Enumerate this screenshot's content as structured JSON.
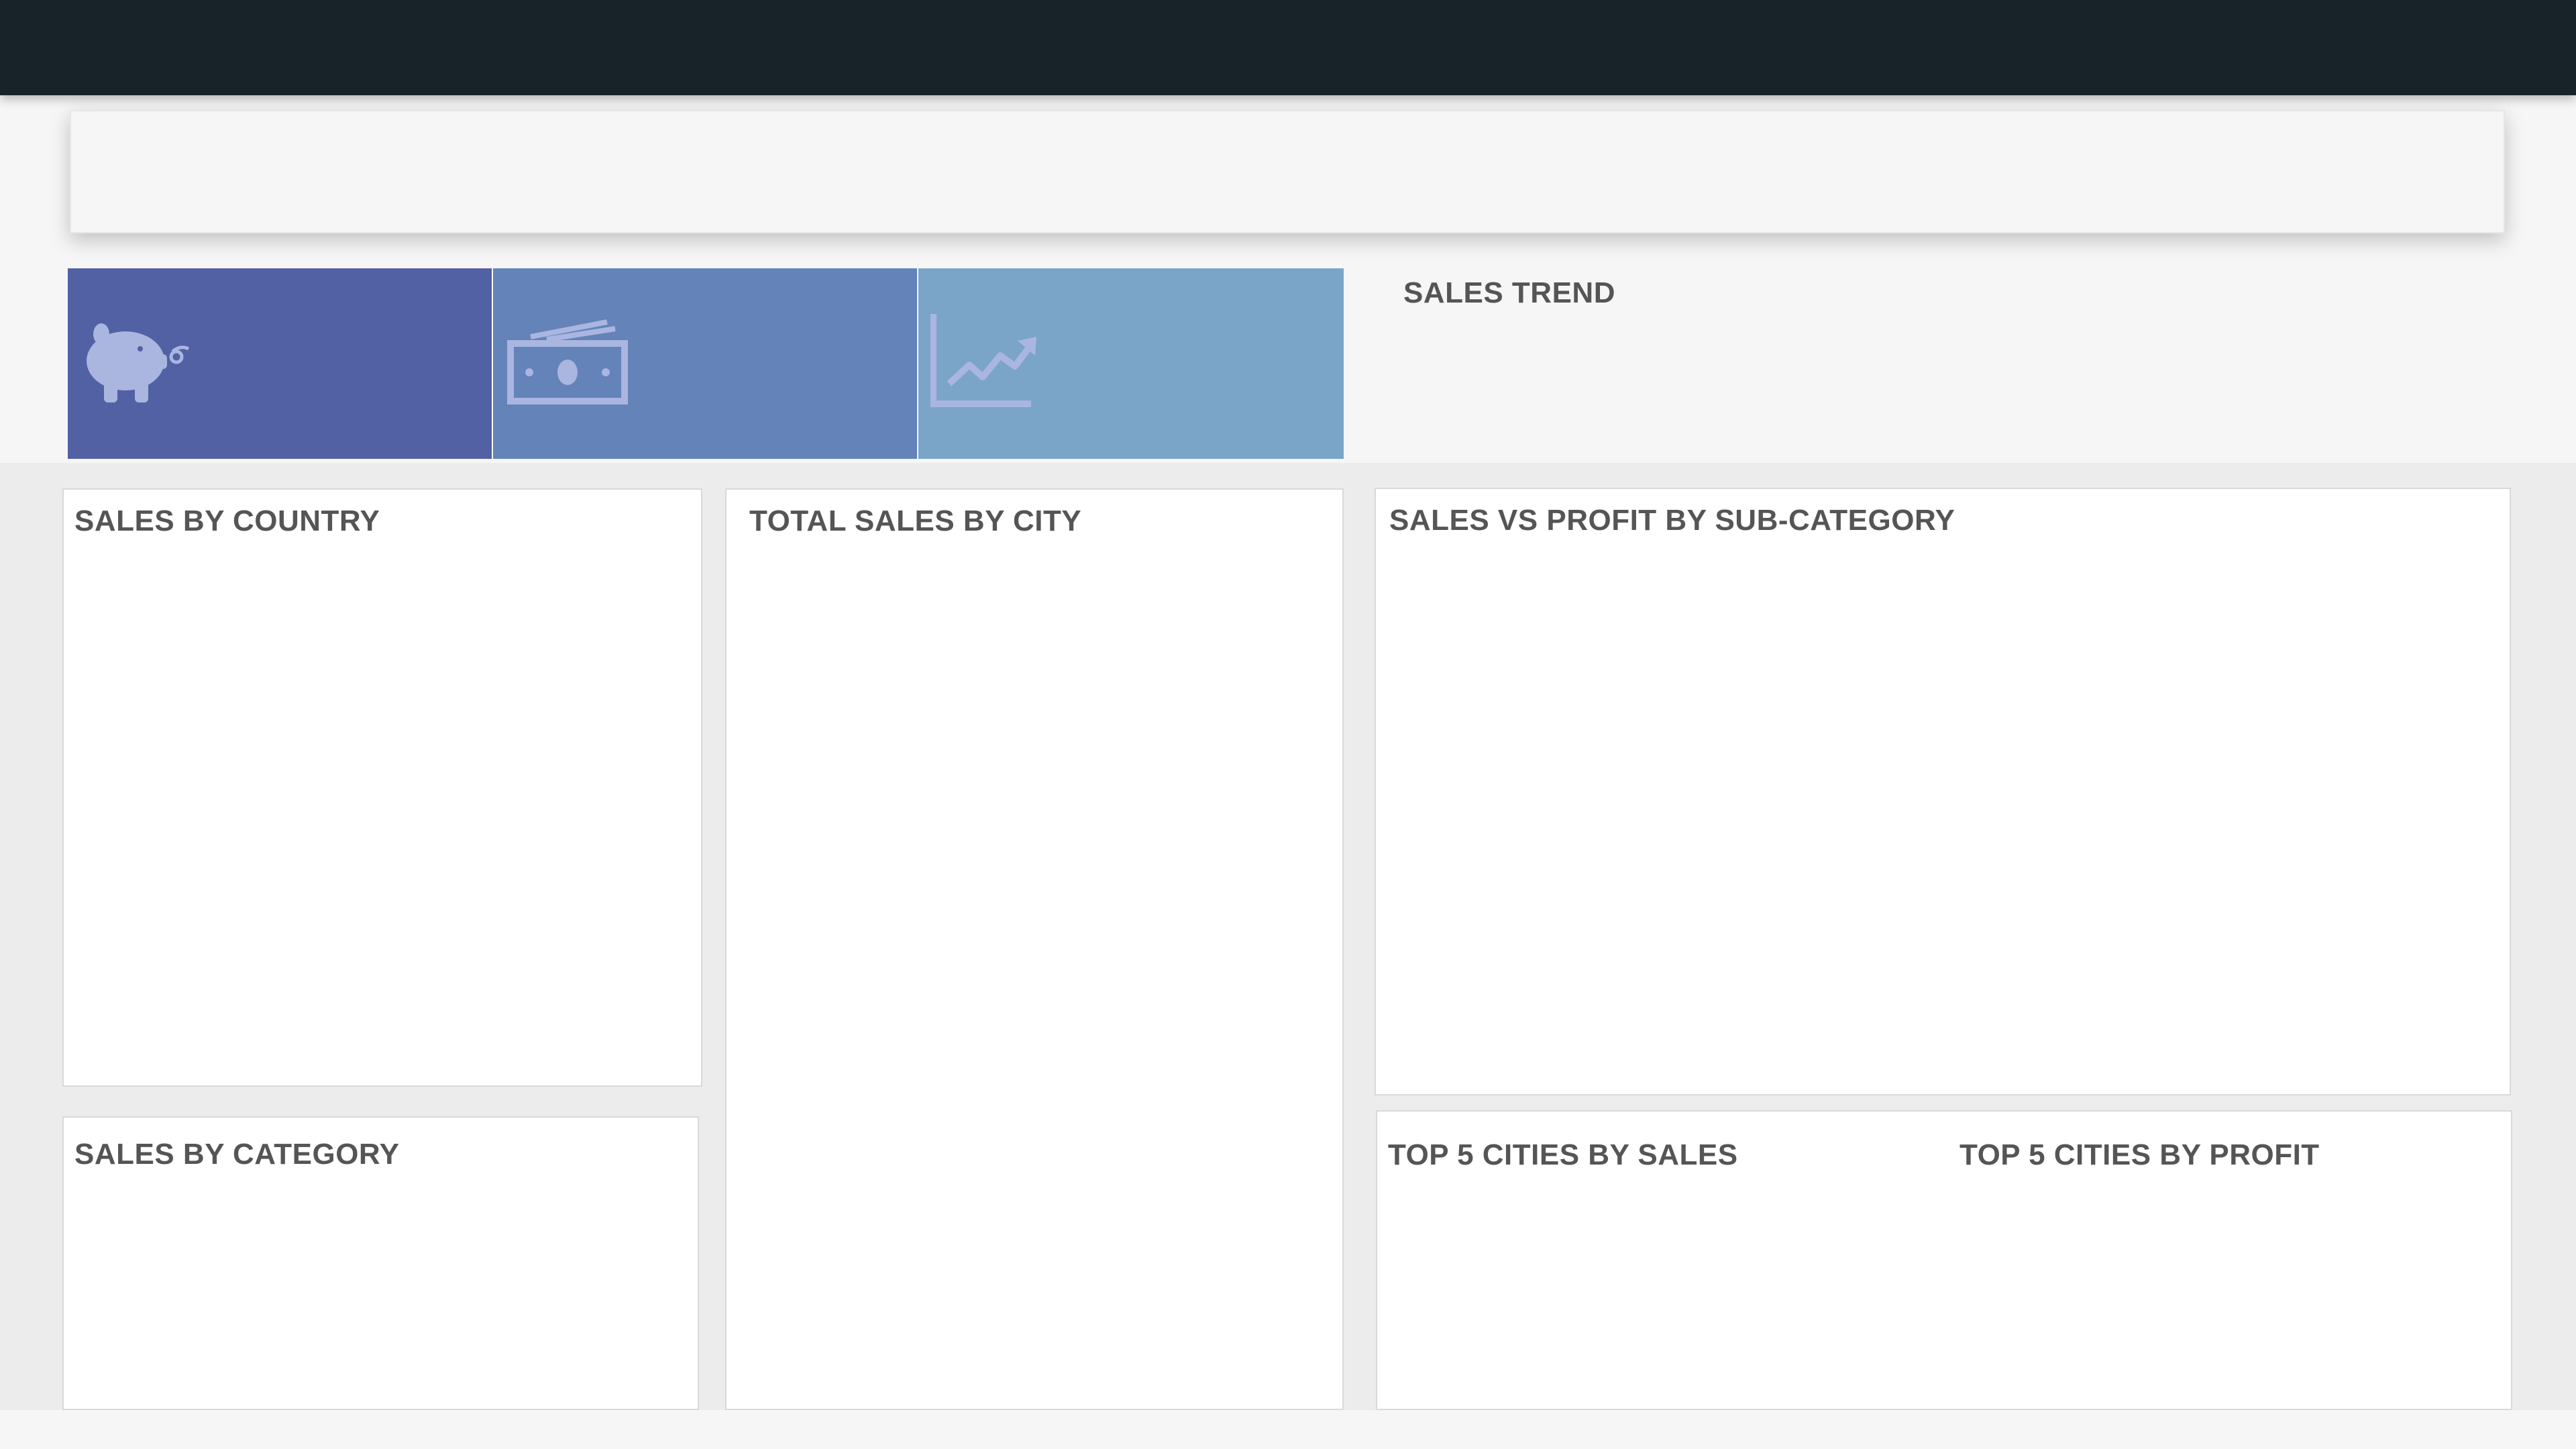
{
  "colors": {
    "topbar": "#182329",
    "kpi_1": "#5260a4",
    "kpi_2": "#6383b9",
    "kpi_3": "#7aa5c8",
    "icon": "#aab6e0",
    "title_text": "#555555"
  },
  "kpis": [
    {
      "icon": "piggy-bank-icon"
    },
    {
      "icon": "money-bills-icon"
    },
    {
      "icon": "line-chart-icon"
    }
  ],
  "trend": {
    "title": "SALES TREND"
  },
  "panels": {
    "sales_by_country": {
      "title": "SALES BY COUNTRY"
    },
    "total_sales_by_city": {
      "title": "TOTAL SALES BY CITY"
    },
    "sales_vs_profit": {
      "title": "SALES VS PROFIT BY SUB-CATEGORY"
    },
    "sales_by_category": {
      "title": "SALES BY CATEGORY"
    },
    "top5_sales": {
      "title": "TOP 5 CITIES BY SALES"
    },
    "top5_profit": {
      "title": "TOP 5 CITIES BY PROFIT"
    }
  }
}
